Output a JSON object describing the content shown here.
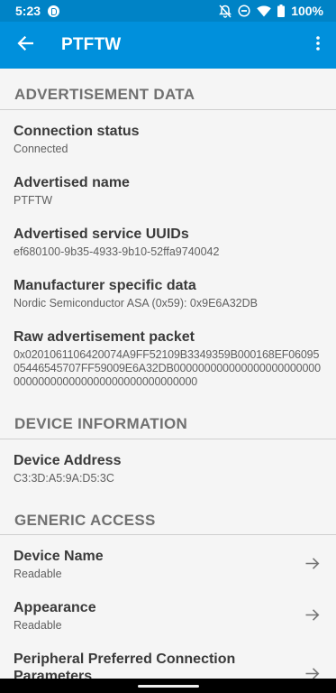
{
  "status_bar": {
    "time": "5:23",
    "battery_percent": "100%",
    "icons": [
      "notification-app-icon",
      "bell-off-icon",
      "do-not-disturb-icon",
      "wifi-icon",
      "battery-icon"
    ]
  },
  "app_bar": {
    "title": "PTFTW",
    "back_icon": "arrow-back-icon",
    "menu_icon": "more-vert-icon"
  },
  "sections": {
    "advertisement": {
      "title": "ADVERTISEMENT DATA",
      "items": [
        {
          "title": "Connection status",
          "value": "Connected"
        },
        {
          "title": "Advertised name",
          "value": "PTFTW"
        },
        {
          "title": "Advertised service UUIDs",
          "value": "ef680100-9b35-4933-9b10-52ffa9740042"
        },
        {
          "title": "Manufacturer specific data",
          "value": "Nordic Semiconductor ASA (0x59): 0x9E6A32DB"
        },
        {
          "title": "Raw advertisement packet",
          "value": "0x0201061106420074A9FF52109B3349359B000168EF0609505446545707FF59009E6A32DB000000000000000000000000000000000000000000000000000000"
        }
      ]
    },
    "device_information": {
      "title": "DEVICE INFORMATION",
      "items": [
        {
          "title": "Device Address",
          "value": "C3:3D:A5:9A:D5:3C"
        }
      ]
    },
    "generic_access": {
      "title": "GENERIC ACCESS",
      "items": [
        {
          "title": "Device Name",
          "value": "Readable"
        },
        {
          "title": "Appearance",
          "value": "Readable"
        },
        {
          "title": "Peripheral Preferred Connection Parameters",
          "value": ""
        }
      ]
    }
  },
  "colors": {
    "status_bar": "#0083c6",
    "app_bar": "#0090dc",
    "background": "#f5f5f5"
  }
}
